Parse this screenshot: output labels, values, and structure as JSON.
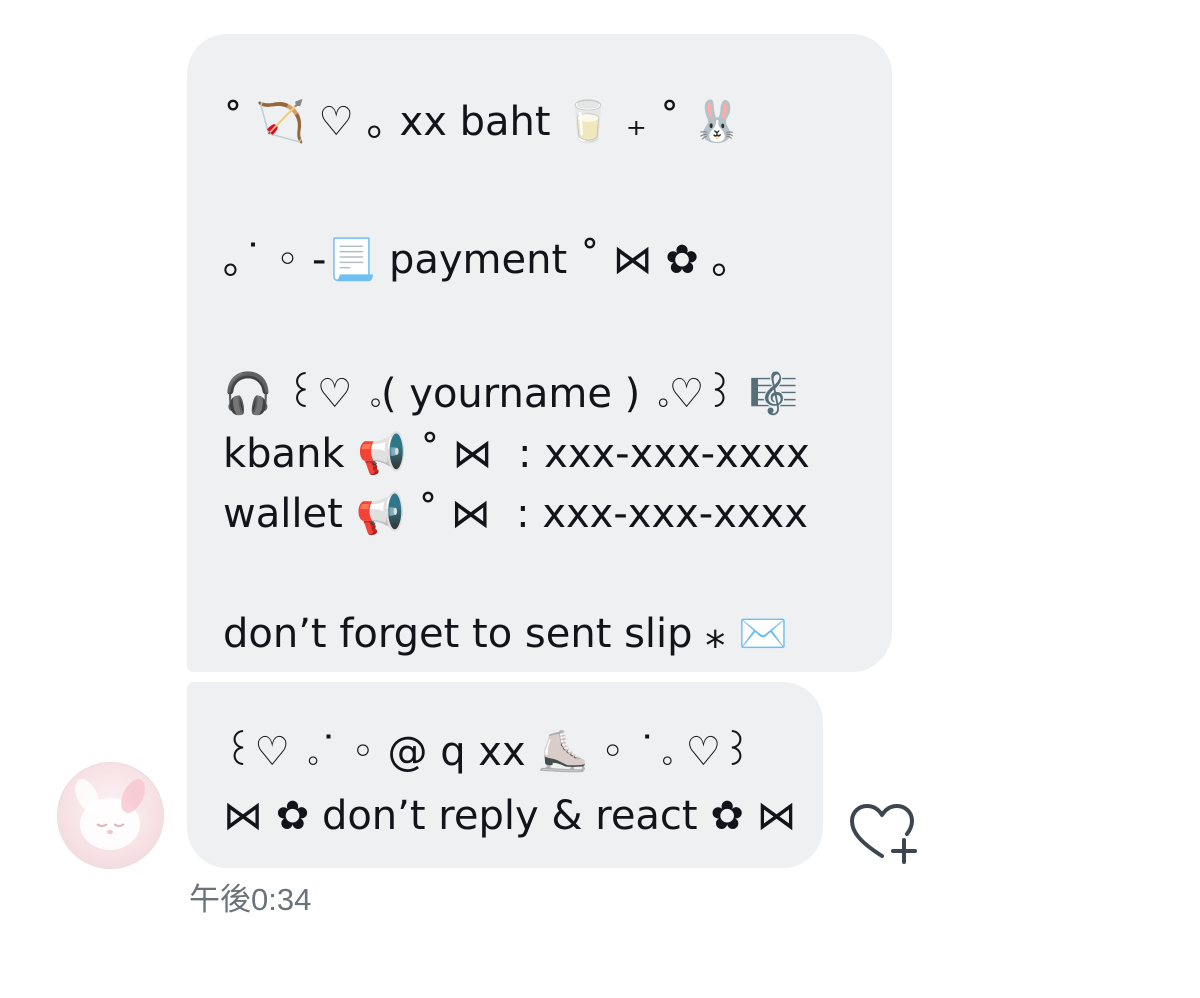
{
  "message_1": {
    "lines": [
      "˚ 🏹 ♡ ｡ xx baht 🥛 ₊ ˚ 🐰",
      "｡˙ ◦ -📃 payment ˚ ⋈ ✿ ｡",
      "🎧 ꒰♡ ｡( yourname ) ｡♡꒱ 🎼",
      "kbank 📢 ˚ ⋈  : xxx-xxx-xxxx",
      "wallet 📢 ˚ ⋈  : xxx-xxx-xxxx",
      "don’t forget to sent slip ⁎ ✉️"
    ]
  },
  "message_2": {
    "lines": [
      "꒰♡ ｡˙ ◦ @ q xx ⛸️ ◦ ˙｡ ♡꒱",
      "⋈ ✿ don’t reply & react ✿ ⋈"
    ]
  },
  "timestamp": "午後0:34",
  "icons": {
    "avatar": "avatar-image",
    "react": "heart-plus-icon"
  },
  "colors": {
    "bubble": "#eef0f2",
    "text": "#111418",
    "timestamp": "#6b7279",
    "react_icon": "#3d4650"
  }
}
